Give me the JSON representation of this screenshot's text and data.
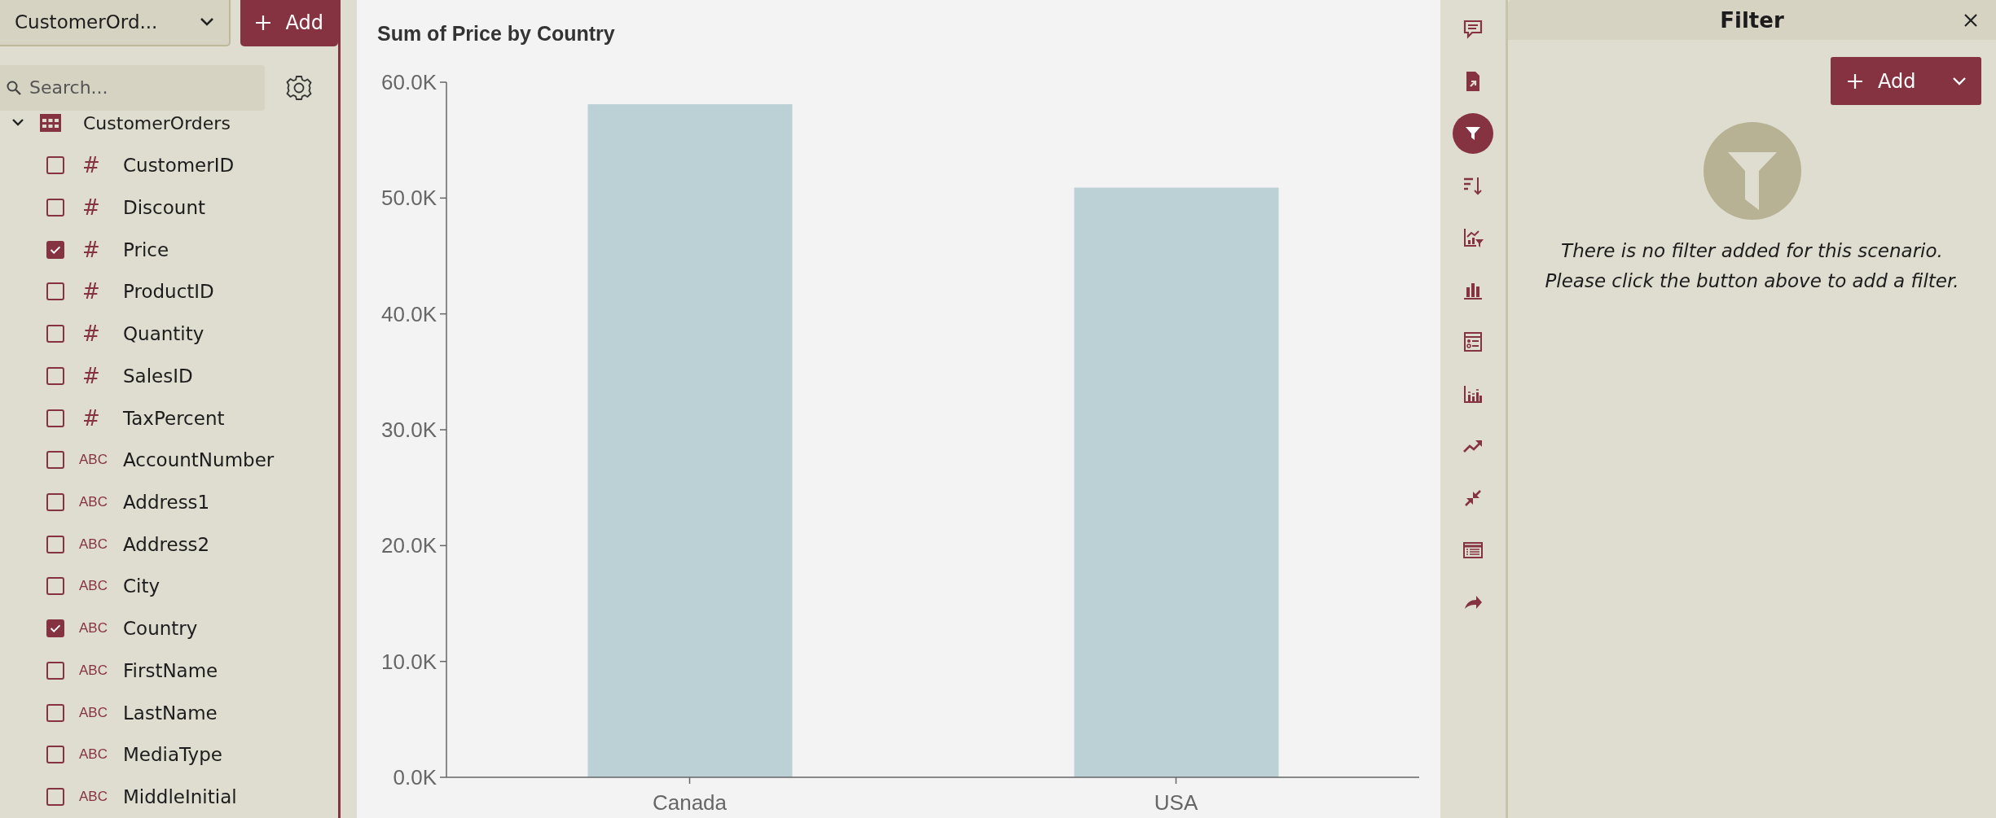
{
  "data_source": {
    "value": "CustomerOrd...",
    "add_button": "Add"
  },
  "search": {
    "placeholder": "Search..."
  },
  "tree": {
    "label": "CustomerOrders",
    "expanded": true,
    "children": [
      {
        "name": "CustomerID",
        "type_label": "#",
        "checked": false
      },
      {
        "name": "Discount",
        "type_label": "#",
        "checked": false
      },
      {
        "name": "Price",
        "type_label": "#",
        "checked": true
      },
      {
        "name": "ProductID",
        "type_label": "#",
        "checked": false
      },
      {
        "name": "Quantity",
        "type_label": "#",
        "checked": false
      },
      {
        "name": "SalesID",
        "type_label": "#",
        "checked": false
      },
      {
        "name": "TaxPercent",
        "type_label": "#",
        "checked": false
      },
      {
        "name": "AccountNumber",
        "type_label": "ABC",
        "checked": false
      },
      {
        "name": "Address1",
        "type_label": "ABC",
        "checked": false
      },
      {
        "name": "Address2",
        "type_label": "ABC",
        "checked": false
      },
      {
        "name": "City",
        "type_label": "ABC",
        "checked": false
      },
      {
        "name": "Country",
        "type_label": "ABC",
        "checked": true
      },
      {
        "name": "FirstName",
        "type_label": "ABC",
        "checked": false
      },
      {
        "name": "LastName",
        "type_label": "ABC",
        "checked": false
      },
      {
        "name": "MediaType",
        "type_label": "ABC",
        "checked": false
      },
      {
        "name": "MiddleInitial",
        "type_label": "ABC",
        "checked": false
      }
    ]
  },
  "chart": {
    "chart_data": {
      "type": "bar",
      "title": "Sum of Price by Country",
      "categories": [
        "Canada",
        "USA"
      ],
      "values": [
        58100,
        50900
      ],
      "ylim": [
        0,
        60000
      ],
      "yticks": [
        {
          "value": 0,
          "label": "0.0K"
        },
        {
          "value": 10000,
          "label": "10.0K"
        },
        {
          "value": 20000,
          "label": "20.0K"
        },
        {
          "value": 30000,
          "label": "30.0K"
        },
        {
          "value": 40000,
          "label": "40.0K"
        },
        {
          "value": 50000,
          "label": "50.0K"
        },
        {
          "value": 60000,
          "label": "60.0K"
        }
      ]
    }
  },
  "toolbar": [
    {
      "kind": "comment",
      "selected": false
    },
    {
      "kind": "export",
      "selected": false
    },
    {
      "kind": "filter",
      "selected": true
    },
    {
      "kind": "sort",
      "selected": false
    },
    {
      "kind": "chart-filter",
      "selected": false
    },
    {
      "kind": "bar-chart",
      "selected": false
    },
    {
      "kind": "legend",
      "selected": false
    },
    {
      "kind": "grouped-bar",
      "selected": false
    },
    {
      "kind": "trend",
      "selected": false
    },
    {
      "kind": "collapse",
      "selected": false
    },
    {
      "kind": "list",
      "selected": false
    },
    {
      "kind": "share",
      "selected": false
    }
  ],
  "filter_panel": {
    "title": "Filter",
    "add_button": "Add",
    "message": [
      "There is no filter added for this scenario.",
      "Please click the button above to add a filter."
    ]
  }
}
